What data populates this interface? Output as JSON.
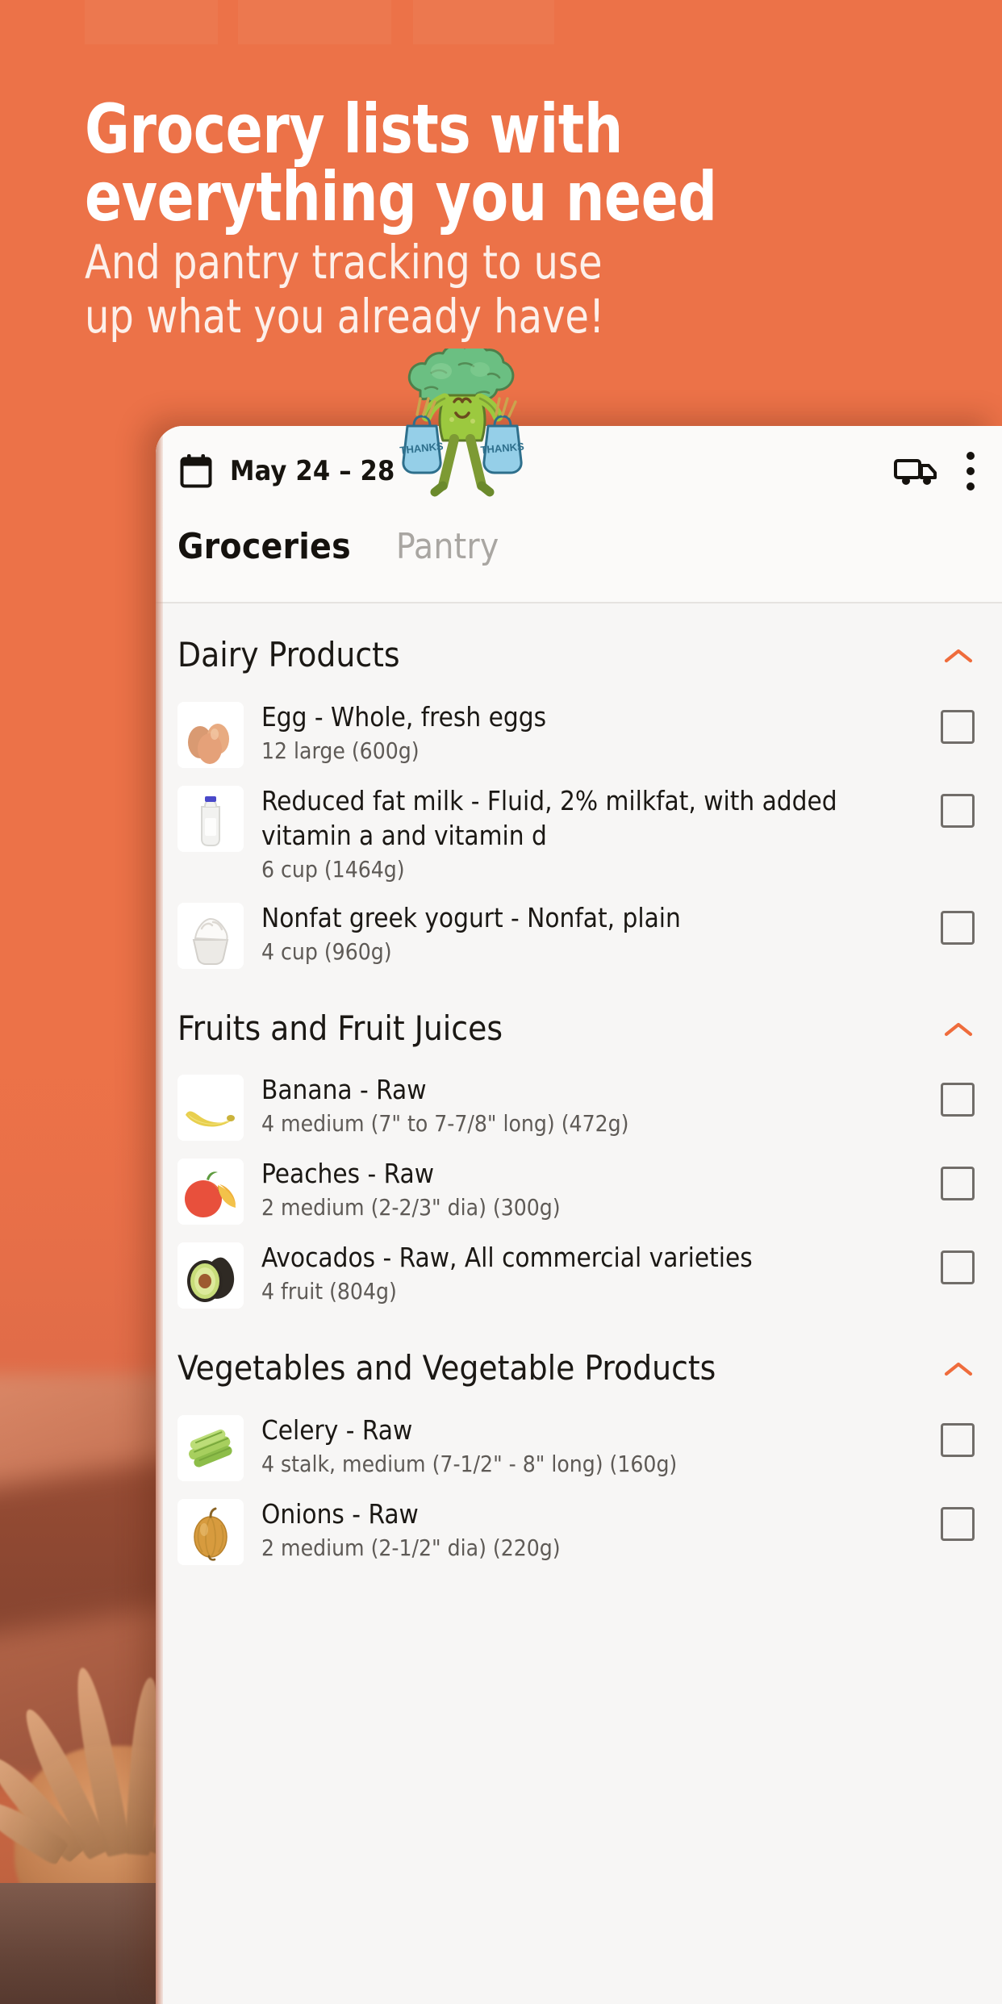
{
  "theme": {
    "brand_orange": "#ec7248",
    "accent_chevron": "#ef6c3c",
    "card_bg": "#f7f6f5",
    "text_dark": "#1b1814",
    "text_muted": "#5e5a56",
    "tab_inactive": "#a9a6a2"
  },
  "hero": {
    "headline_line1": "Grocery lists with",
    "headline_line2": "everything you need",
    "sub_line1": "And pantry tracking to use",
    "sub_line2": "up what you already have!"
  },
  "mascot": {
    "name": "broccoli-mascot",
    "bag_label_left": "THANKS",
    "bag_label_right": "THANKS"
  },
  "appbar": {
    "calendar_icon": "calendar-icon",
    "date_range": "May 24 – 28",
    "delivery_icon": "truck-icon",
    "overflow_icon": "kebab-menu-icon"
  },
  "tabs": [
    {
      "label": "Groceries",
      "active": true
    },
    {
      "label": "Pantry",
      "active": false
    }
  ],
  "sections": [
    {
      "title": "Dairy Products",
      "collapse_icon": "chevron-up-icon",
      "items": [
        {
          "thumb": "eggs-image",
          "name": "Egg - Whole, fresh eggs",
          "qty": "12 large (600g)",
          "checked": false
        },
        {
          "thumb": "milk-image",
          "name": "Reduced fat milk - Fluid, 2% milkfat, with added vitamin a and vitamin d",
          "qty": "6 cup (1464g)",
          "checked": false
        },
        {
          "thumb": "yogurt-image",
          "name": "Nonfat greek yogurt - Nonfat, plain",
          "qty": "4 cup (960g)",
          "checked": false
        }
      ]
    },
    {
      "title": "Fruits and Fruit Juices",
      "collapse_icon": "chevron-up-icon",
      "items": [
        {
          "thumb": "banana-image",
          "name": "Banana - Raw",
          "qty": "4 medium (7\" to 7-7/8\" long) (472g)",
          "checked": false
        },
        {
          "thumb": "peach-image",
          "name": "Peaches - Raw",
          "qty": "2 medium (2-2/3\" dia) (300g)",
          "checked": false
        },
        {
          "thumb": "avocado-image",
          "name": "Avocados - Raw, All commercial varieties",
          "qty": "4 fruit (804g)",
          "checked": false
        }
      ]
    },
    {
      "title": "Vegetables and Vegetable Products",
      "collapse_icon": "chevron-up-icon",
      "items": [
        {
          "thumb": "celery-image",
          "name": "Celery - Raw",
          "qty": "4 stalk, medium (7-1/2\" - 8\" long) (160g)",
          "checked": false
        },
        {
          "thumb": "onion-image",
          "name": "Onions - Raw",
          "qty": "2 medium (2-1/2\" dia) (220g)",
          "checked": false
        }
      ]
    }
  ]
}
